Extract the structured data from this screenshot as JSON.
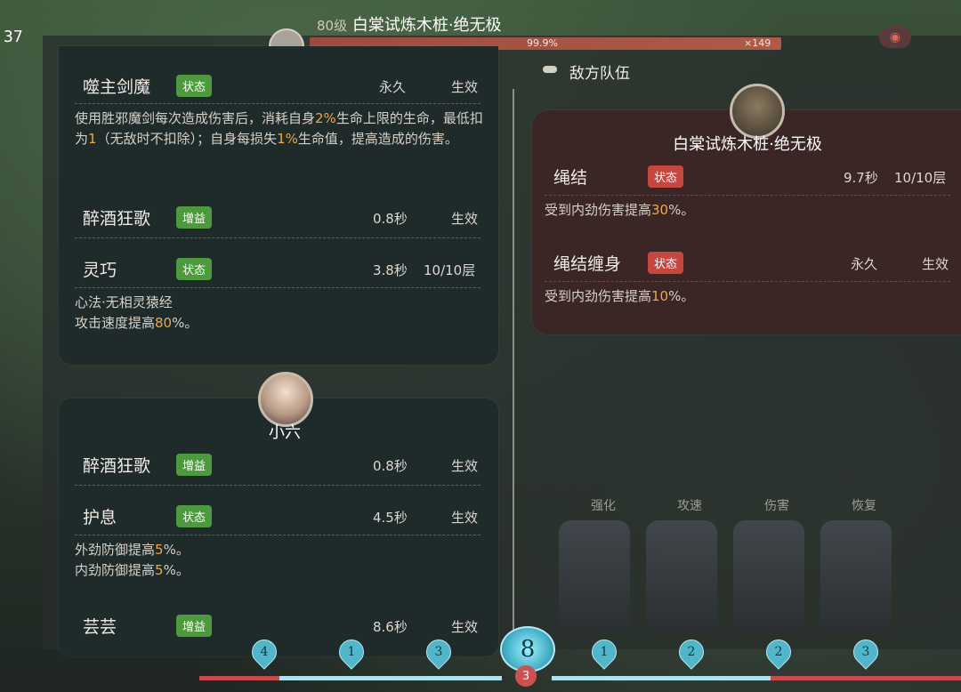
{
  "hud": {
    "fps": "37",
    "boss_level": "80级",
    "boss_name": "白棠试炼木桩·绝无极",
    "hp_percent": "99.9%",
    "hp_multiplier": "×149",
    "hp_fraction": 0.999
  },
  "ally_panel_1": {
    "buffs": [
      {
        "name": "噬主剑魔",
        "tag": "状态",
        "tag_color": "green",
        "duration": "永久",
        "effect": "生效",
        "desc_parts": [
          "使用胜邪魔剑每次造成伤害后，消耗自身",
          "2%",
          "生命上限的生命，最低扣为",
          "1",
          "（无敌时不扣除）；自身每损失",
          "1%",
          "生命值，提高造成的伤害。"
        ]
      },
      {
        "name": "醉酒狂歌",
        "tag": "增益",
        "tag_color": "green",
        "duration": "0.8秒",
        "effect": "生效"
      },
      {
        "name": "灵巧",
        "tag": "状态",
        "tag_color": "green",
        "duration": "3.8秒",
        "effect": "10/10层",
        "desc_line1": "心法·无相灵猿经",
        "desc_line2_pre": "攻击速度提高",
        "desc_line2_hl": "80",
        "desc_line2_post": "%。"
      }
    ]
  },
  "ally_panel_2": {
    "name": "小六",
    "buffs": [
      {
        "name": "醉酒狂歌",
        "tag": "增益",
        "tag_color": "green",
        "duration": "0.8秒",
        "effect": "生效"
      },
      {
        "name": "护息",
        "tag": "状态",
        "tag_color": "green",
        "duration": "4.5秒",
        "effect": "生效",
        "desc_line1_pre": "外劲防御提高",
        "desc_line1_hl": "5",
        "desc_line1_post": "%。",
        "desc_line2_pre": "内劲防御提高",
        "desc_line2_hl": "5",
        "desc_line2_post": "%。"
      },
      {
        "name": "芸芸",
        "tag": "增益",
        "tag_color": "green",
        "duration": "8.6秒",
        "effect": "生效"
      }
    ]
  },
  "enemy": {
    "section_label": "敌方队伍",
    "name": "白棠试炼木桩·绝无极",
    "buffs": [
      {
        "name": "绳结",
        "tag": "状态",
        "tag_color": "red",
        "duration": "9.7秒",
        "effect": "10/10层",
        "desc_pre": "受到内劲伤害提高",
        "desc_hl": "30",
        "desc_post": "%。"
      },
      {
        "name": "绳结缠身",
        "tag": "状态",
        "tag_color": "red",
        "duration": "永久",
        "effect": "生效",
        "desc_pre": "受到内劲伤害提高",
        "desc_hl": "10",
        "desc_post": "%。"
      }
    ]
  },
  "skill_bar": {
    "left_gems": [
      "4",
      "1",
      "3"
    ],
    "center_value": "8",
    "center_sub": "3",
    "right_gems": [
      "1",
      "2",
      "2",
      "3"
    ],
    "categories": [
      "强化",
      "攻速",
      "伤害",
      "恢复"
    ]
  },
  "colors": {
    "tag_green": "#4d9a3c",
    "tag_red": "#c9463e",
    "highlight": "#f0a83a"
  }
}
